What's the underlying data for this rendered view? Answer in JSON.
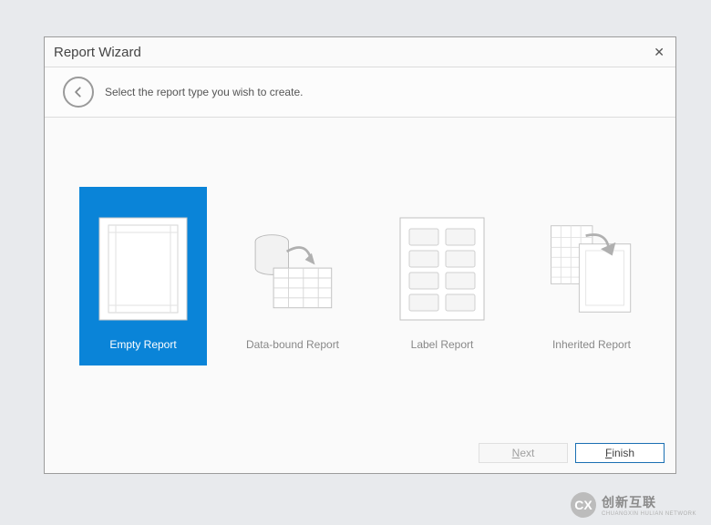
{
  "dialog": {
    "title": "Report Wizard",
    "instruction": "Select the report type you wish to create."
  },
  "options": [
    {
      "label": "Empty Report",
      "selected": true
    },
    {
      "label": "Data-bound Report",
      "selected": false
    },
    {
      "label": "Label Report",
      "selected": false
    },
    {
      "label": "Inherited Report",
      "selected": false
    }
  ],
  "buttons": {
    "next": "Next",
    "finish": "Finish"
  },
  "watermark": {
    "badge": "CX",
    "line1": "创新互联",
    "line2": "CHUANGXIN HULIAN NETWORK"
  }
}
